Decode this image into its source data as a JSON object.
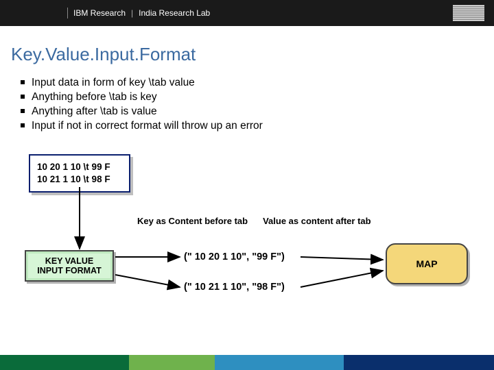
{
  "header": {
    "org": "IBM Research",
    "lab": "India Research Lab",
    "logo_name": "ibm-logo"
  },
  "title": "Key.Value.Input.Format",
  "bullets": [
    "Input data in form of key \\tab value",
    "Anything before \\tab is key",
    "Anything after  \\tab is value",
    "Input if not in correct format will throw up an error"
  ],
  "databox": {
    "line1": "10 20 1 10 \\t 99 F",
    "line2": "10 21 1 10 \\t 98 F"
  },
  "labels": {
    "key_label": "Key as Content before tab",
    "value_label": "Value as content after tab"
  },
  "kvif_label_line1": "KEY VALUE",
  "kvif_label_line2": "INPUT FORMAT",
  "pairs": {
    "p1": "(\" 10 20 1 10\", \"99 F\")",
    "p2": "(\" 10 21 1 10\", \"98 F\")"
  },
  "map_label": "MAP",
  "colors": {
    "title": "#3b6aa0",
    "databox_border": "#0a1e6e",
    "kvif_bg": "#d6f5d6",
    "map_bg": "#f4d77a",
    "footer": [
      "#0a6b3a",
      "#6fb24c",
      "#2e8fc0",
      "#0a2f6c"
    ]
  }
}
